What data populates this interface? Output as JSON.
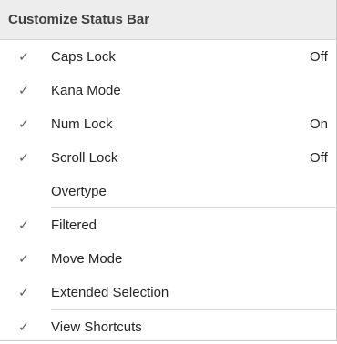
{
  "menu": {
    "title": "Customize Status Bar",
    "check_glyph": "✓",
    "items": [
      {
        "label": "Caps Lock",
        "value": "Off",
        "checked": true
      },
      {
        "label": "Kana Mode",
        "value": "",
        "checked": true
      },
      {
        "label": "Num Lock",
        "value": "On",
        "checked": true
      },
      {
        "label": "Scroll Lock",
        "value": "Off",
        "checked": true
      },
      {
        "label": "Overtype",
        "value": "",
        "checked": false
      },
      {
        "label": "Filtered",
        "value": "",
        "checked": true
      },
      {
        "label": "Move Mode",
        "value": "",
        "checked": true
      },
      {
        "label": "Extended Selection",
        "value": "",
        "checked": true
      },
      {
        "label": "View Shortcuts",
        "value": "",
        "checked": true
      }
    ]
  }
}
